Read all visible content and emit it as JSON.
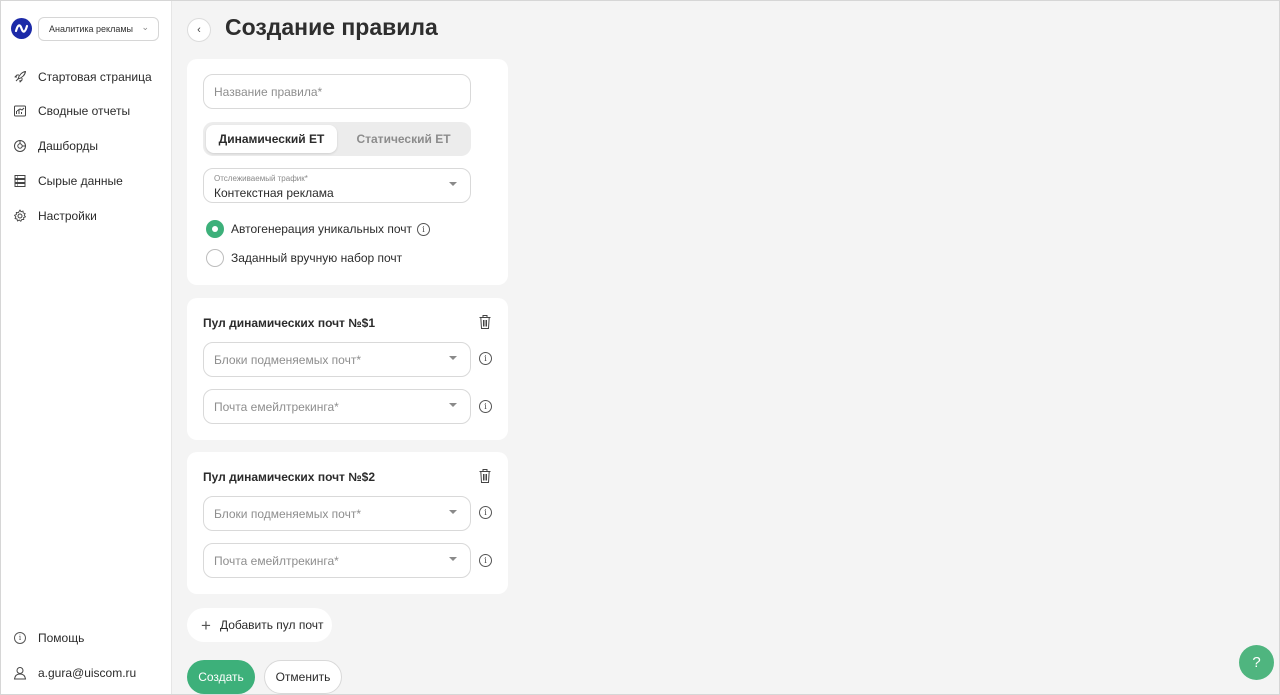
{
  "sidebar": {
    "workspace": "Аналитика рекламы",
    "items": [
      {
        "label": "Стартовая страница",
        "icon": "rocket-icon"
      },
      {
        "label": "Сводные отчеты",
        "icon": "report-icon"
      },
      {
        "label": "Дашборды",
        "icon": "dashboard-icon"
      },
      {
        "label": "Сырые данные",
        "icon": "raw-data-icon"
      },
      {
        "label": "Настройки",
        "icon": "gear-icon"
      }
    ],
    "help_label": "Помощь",
    "user_email": "a.gura@uiscom.ru"
  },
  "page": {
    "title": "Создание правила"
  },
  "form": {
    "name_placeholder": "Название правила*",
    "mode_tabs": {
      "active": "Динамический ЕТ",
      "inactive": "Статический ЕТ"
    },
    "traffic": {
      "label": "Отслеживаемый трафик*",
      "value": "Контекстная реклама"
    },
    "options": {
      "auto": "Автогенерация уникальных почт",
      "manual": "Заданный вручную набор почт"
    }
  },
  "pools": [
    {
      "title": "Пул динамических почт №$1",
      "blocks_placeholder": "Блоки подменяемых почт*",
      "email_placeholder": "Почта емейлтрекинга*"
    },
    {
      "title": "Пул динамических почт №$2",
      "blocks_placeholder": "Блоки подменяемых почт*",
      "email_placeholder": "Почта емейлтрекинга*"
    }
  ],
  "actions": {
    "add_pool": "Добавить пул почт",
    "create": "Создать",
    "cancel": "Отменить"
  },
  "fab": {
    "help_glyph": "?"
  },
  "colors": {
    "accent": "#3db07a",
    "brand": "#1c2aa8",
    "background": "#f4f4f4"
  }
}
